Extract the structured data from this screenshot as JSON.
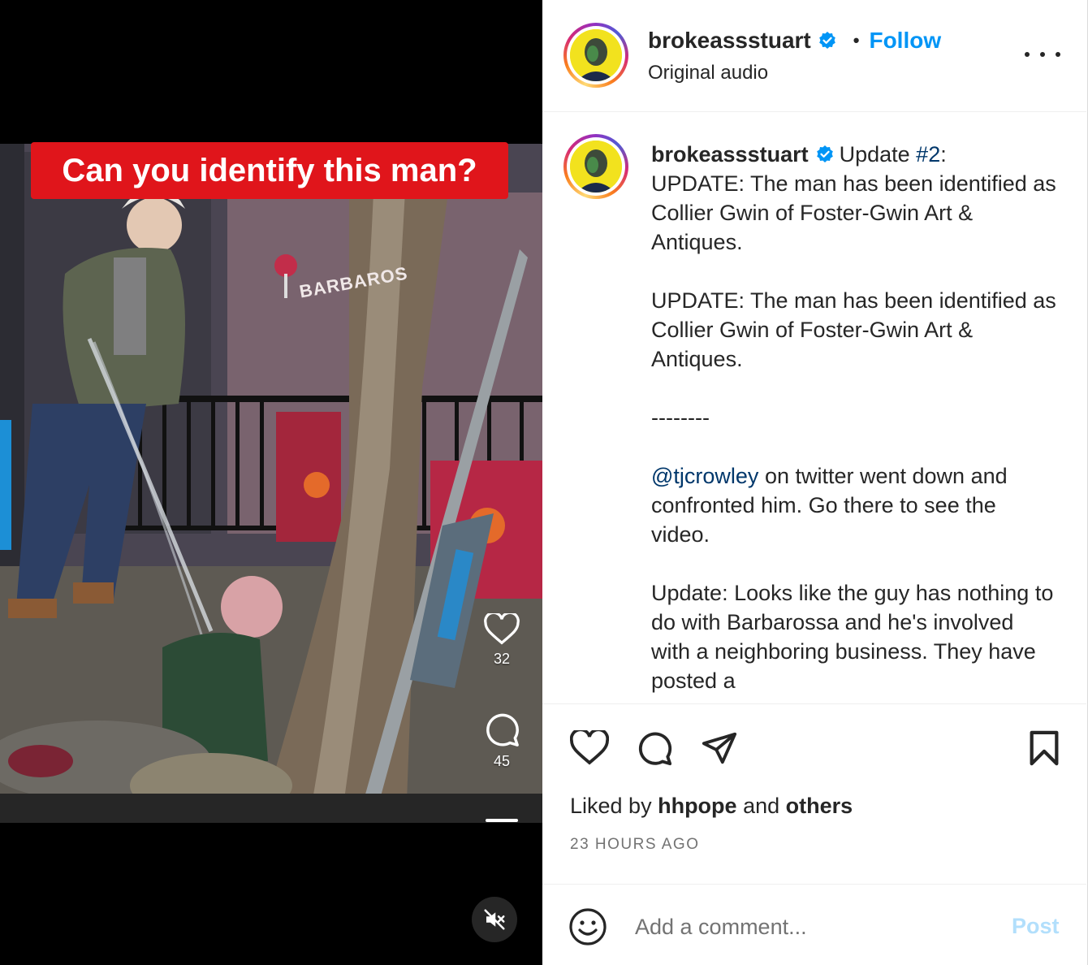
{
  "media": {
    "overlay_text": "Can you identify this man?",
    "storefront_text": "BARBAROS",
    "like_count": "32",
    "comment_count": "45",
    "icons": {
      "like": "heart-outline-icon",
      "comment": "comment-bubble-icon",
      "mute": "speaker-muted-icon"
    }
  },
  "header": {
    "username": "brokeassstuart",
    "separator": "•",
    "follow_label": "Follow",
    "subtitle": "Original audio"
  },
  "caption": {
    "username": "brokeassstuart",
    "intro": "Update ",
    "hashtag": "#2",
    "intro_tail": ":",
    "para1": "UPDATE: The man has been identified as Collier Gwin of Foster-Gwin Art & Antiques.",
    "para2": "UPDATE: The man has been identified as Collier Gwin of Foster-Gwin Art & Antiques.",
    "divider": "--------",
    "mention": "@tjcrowley",
    "para3_tail": " on twitter went down and confronted him. Go there to see the video.",
    "para4": "Update: Looks like the guy has nothing to do with Barbarossa and he's involved with a neighboring business. They have posted a"
  },
  "actions": {
    "liked_prefix": "Liked by ",
    "liked_user": "hhpope",
    "liked_and": " and ",
    "liked_others": "others",
    "time_ago": "23 HOURS AGO"
  },
  "comment": {
    "placeholder": "Add a comment...",
    "post_label": "Post"
  },
  "colors": {
    "accent": "#0095f6",
    "overlay_red": "#e0151b",
    "link": "#00376b",
    "post_disabled": "#b2dffc"
  }
}
